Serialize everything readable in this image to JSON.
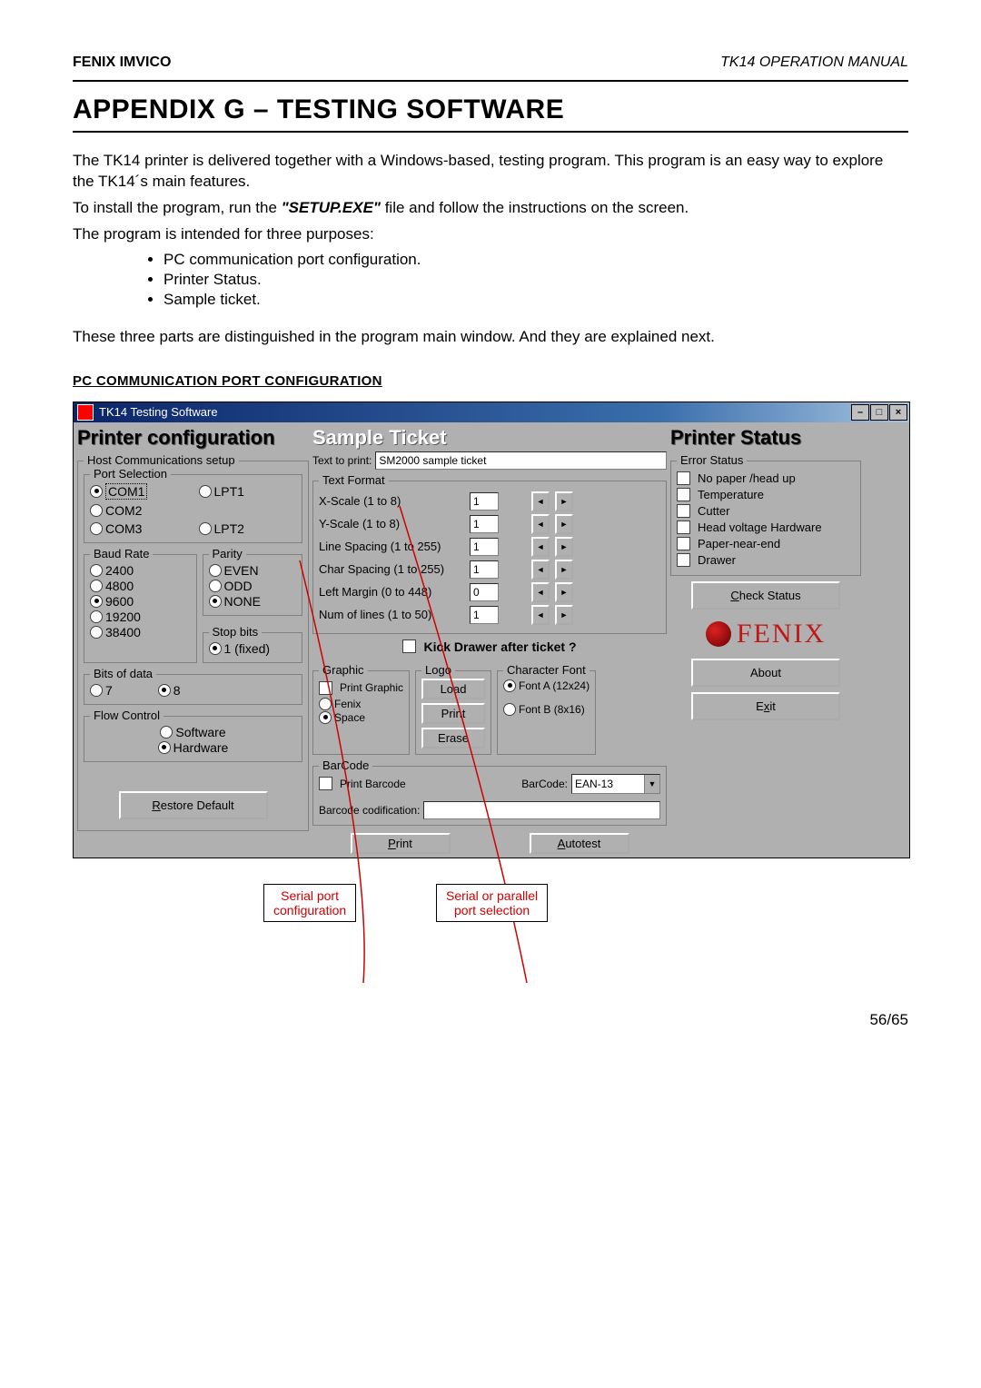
{
  "header": {
    "left": "FENIX IMVICO",
    "right": "TK14   OPERATION  MANUAL"
  },
  "title": "APPENDIX G – TESTING SOFTWARE",
  "para1a": "The TK14 printer is delivered together with a Windows-based, testing program. This program is an easy way to explore the TK14´s main features.",
  "para1b_pre": "To install the program, run the ",
  "para1b_bi": "\"SETUP.EXE\"",
  "para1b_post": " file and follow the instructions on the screen.",
  "para1c": "The program is intended for three purposes:",
  "bullets": [
    "PC communication port configuration.",
    "Printer Status.",
    "Sample ticket."
  ],
  "para2": "These three parts are distinguished in the program main window. And they are explained next.",
  "section": "PC COMMUNICATION PORT CONFIGURATION",
  "app": {
    "title": "TK14 Testing Software",
    "left_head": "Printer configuration",
    "mid_head": "Sample Ticket",
    "right_head": "Printer Status",
    "host_setup": "Host Communications setup",
    "port_selection": "Port Selection",
    "ports": [
      "COM1",
      "COM2",
      "COM3",
      "LPT1",
      "LPT2"
    ],
    "baud": {
      "legend": "Baud Rate",
      "opts": [
        "2400",
        "4800",
        "9600",
        "19200",
        "38400"
      ],
      "selected": "9600"
    },
    "parity": {
      "legend": "Parity",
      "opts": [
        "EVEN",
        "ODD",
        "NONE"
      ],
      "selected": "NONE"
    },
    "stop": {
      "legend": "Stop bits",
      "label": "1 (fixed)"
    },
    "bits": {
      "legend": "Bits of data",
      "opts": [
        "7",
        "8"
      ],
      "selected": "8"
    },
    "flow": {
      "legend": "Flow Control",
      "opts": [
        "Software",
        "Hardware"
      ],
      "selected": "Hardware"
    },
    "restore": "Restore Default",
    "text_to_print_lbl": "Text to print:",
    "text_to_print_val": "SM2000 sample ticket",
    "tf": {
      "legend": "Text Format",
      "rows": [
        {
          "label": "X-Scale (1 to 8)",
          "val": "1"
        },
        {
          "label": "Y-Scale (1 to 8)",
          "val": "1"
        },
        {
          "label": "Line Spacing (1 to 255)",
          "val": "1"
        },
        {
          "label": "Char Spacing (1 to 255)",
          "val": "1"
        },
        {
          "label": "Left Margin (0 to 448)",
          "val": "0"
        },
        {
          "label": "Num of lines (1 to 50)",
          "val": "1"
        }
      ]
    },
    "kick": "Kick Drawer after ticket ?",
    "graphic": {
      "legend": "Graphic",
      "print": "Print Graphic",
      "opts": [
        "Fenix",
        "Space"
      ],
      "selected": "Space"
    },
    "logo": {
      "legend": "Logo",
      "load": "Load",
      "print": "Print",
      "erase": "Erase"
    },
    "font": {
      "legend": "Character Font",
      "a": "Font A (12x24)",
      "b": "Font B (8x16)",
      "selected": "a"
    },
    "bc": {
      "legend": "BarCode",
      "cb": "Print Barcode",
      "type_lbl": "BarCode:",
      "type": "EAN-13",
      "codif": "Barcode codification:"
    },
    "print_btn": "Print",
    "autotest": "Autotest",
    "err": {
      "legend": "Error Status",
      "items": [
        "No paper /head up",
        "Temperature",
        "Cutter",
        "Head voltage Hardware",
        "Paper-near-end",
        "Drawer"
      ]
    },
    "check": "Check Status",
    "about": "About",
    "exit": "Exit",
    "brand": "FENIX"
  },
  "annot1": "Serial port\nconfiguration",
  "annot2": "Serial or parallel\nport selection",
  "page": "56/65"
}
